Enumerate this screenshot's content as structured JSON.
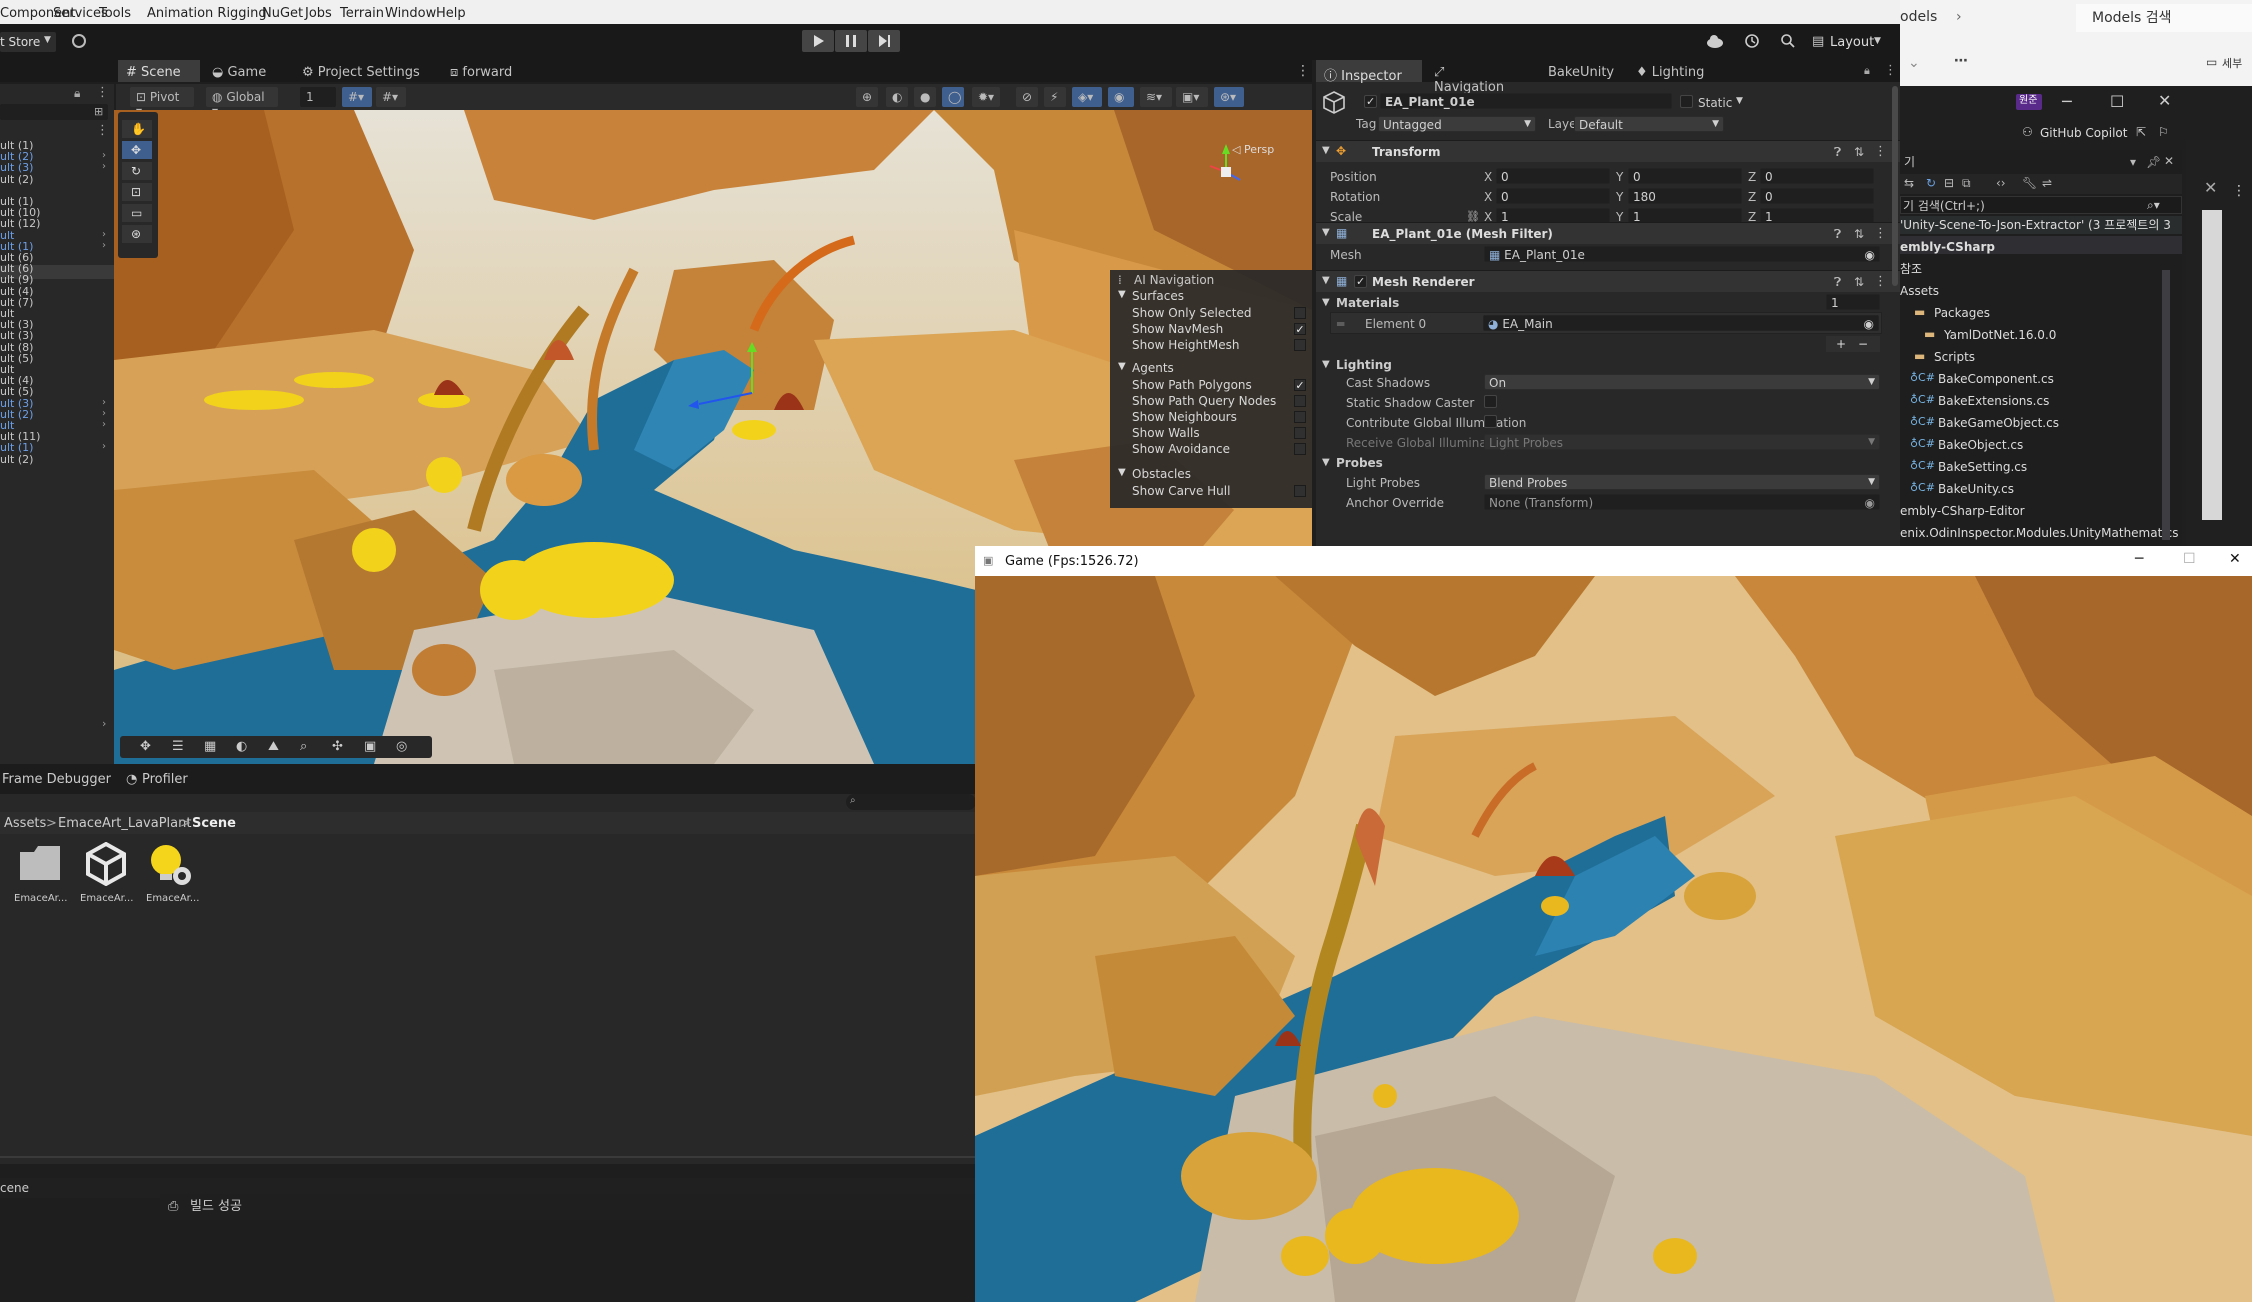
{
  "menubar": {
    "items": [
      "Component",
      "Services",
      "Tools",
      "Animation Rigging",
      "NuGet",
      "Jobs",
      "Terrain",
      "Window",
      "Help"
    ]
  },
  "toolbar": {
    "asset_store_label": "t Store",
    "layout_label": "Layout"
  },
  "scene_tabs": [
    {
      "label": "Scene",
      "icon": "grid-icon"
    },
    {
      "label": "Game",
      "icon": "gamepad-icon"
    },
    {
      "label": "Project Settings",
      "icon": "gear-icon"
    },
    {
      "label": "forward",
      "icon": "frame-icon"
    }
  ],
  "scene_toolbar": {
    "pivot_label": "Pivot",
    "global_label": "Global",
    "grid_value": "1"
  },
  "gizmo": {
    "persp_label": "◁ Persp"
  },
  "hierarchy": {
    "rows": [
      {
        "text": "ult (1)",
        "blue": false,
        "arrow": false
      },
      {
        "text": "ult (2)",
        "blue": true,
        "arrow": true
      },
      {
        "text": "ult (3)",
        "blue": true,
        "arrow": true
      },
      {
        "text": "ult (2)",
        "blue": false,
        "arrow": false
      },
      {
        "text": "",
        "blue": false,
        "arrow": false
      },
      {
        "text": "ult (1)",
        "blue": false,
        "arrow": false
      },
      {
        "text": "ult (10)",
        "blue": false,
        "arrow": false
      },
      {
        "text": "ult (12)",
        "blue": false,
        "arrow": false
      },
      {
        "text": "ult",
        "blue": true,
        "arrow": true
      },
      {
        "text": "ult (1)",
        "blue": true,
        "arrow": true
      },
      {
        "text": "ult (6)",
        "blue": false,
        "arrow": false
      },
      {
        "text": "ult (6)",
        "blue": false,
        "arrow": false
      },
      {
        "text": "ult (9)",
        "blue": false,
        "arrow": false
      },
      {
        "text": "ult (4)",
        "blue": false,
        "arrow": false
      },
      {
        "text": "ult (7)",
        "blue": false,
        "arrow": false
      },
      {
        "text": "ult",
        "blue": false,
        "arrow": false
      },
      {
        "text": "ult (3)",
        "blue": false,
        "arrow": false
      },
      {
        "text": "ult (3)",
        "blue": false,
        "arrow": false
      },
      {
        "text": "ult (8)",
        "blue": false,
        "arrow": false
      },
      {
        "text": "ult (5)",
        "blue": false,
        "arrow": false
      },
      {
        "text": "ult",
        "blue": false,
        "arrow": false
      },
      {
        "text": "ult (4)",
        "blue": false,
        "arrow": false
      },
      {
        "text": "ult (5)",
        "blue": false,
        "arrow": false
      },
      {
        "text": "ult (3)",
        "blue": true,
        "arrow": true
      },
      {
        "text": "ult (2)",
        "blue": true,
        "arrow": true
      },
      {
        "text": "ult",
        "blue": true,
        "arrow": true
      },
      {
        "text": "ult (11)",
        "blue": false,
        "arrow": false
      },
      {
        "text": "ult (1)",
        "blue": true,
        "arrow": true
      },
      {
        "text": "ult (2)",
        "blue": false,
        "arrow": false
      }
    ]
  },
  "ai_navigation": {
    "title": "AI Navigation",
    "surfaces_label": "Surfaces",
    "surfaces": [
      {
        "label": "Show Only Selected",
        "checked": false
      },
      {
        "label": "Show NavMesh",
        "checked": true
      },
      {
        "label": "Show HeightMesh",
        "checked": false
      }
    ],
    "agents_label": "Agents",
    "agents": [
      {
        "label": "Show Path Polygons",
        "checked": true
      },
      {
        "label": "Show Path Query Nodes",
        "checked": false
      },
      {
        "label": "Show Neighbours",
        "checked": false
      },
      {
        "label": "Show Walls",
        "checked": false
      },
      {
        "label": "Show Avoidance",
        "checked": false
      }
    ],
    "obstacles_label": "Obstacles",
    "obstacles": [
      {
        "label": "Show Carve Hull",
        "checked": false
      }
    ]
  },
  "bottom_tabs": {
    "frame_debugger": "Frame Debugger",
    "profiler": "Profiler"
  },
  "project": {
    "breadcrumb": [
      "Assets",
      "EmaceArt_LavaPlant",
      "Scene"
    ],
    "assets": [
      {
        "label": "EmaceAr...",
        "icon": "folder-icon"
      },
      {
        "label": "EmaceAr...",
        "icon": "unity-scene-icon"
      },
      {
        "label": "EmaceAr...",
        "icon": "lighting-settings-icon"
      }
    ]
  },
  "status": {
    "scene_label": "cene",
    "build_label": "빌드 성공"
  },
  "inspector": {
    "tabs": [
      "Inspector",
      "Navigation",
      "BakeUnity",
      "Lighting"
    ],
    "object_name": "EA_Plant_01e",
    "static_label": "Static",
    "tag_label": "Tag",
    "tag_value": "Untagged",
    "layer_label": "Layer",
    "layer_value": "Default",
    "transform": {
      "title": "Transform",
      "position_label": "Position",
      "position": [
        "0",
        "0",
        "0"
      ],
      "rotation_label": "Rotation",
      "rotation": [
        "0",
        "180",
        "0"
      ],
      "scale_label": "Scale",
      "scale": [
        "1",
        "1",
        "1"
      ]
    },
    "mesh_filter": {
      "title": "EA_Plant_01e (Mesh Filter)",
      "mesh_label": "Mesh",
      "mesh_value": "EA_Plant_01e"
    },
    "mesh_renderer": {
      "title": "Mesh Renderer",
      "materials_label": "Materials",
      "materials_count": "1",
      "element_label": "Element 0",
      "element_value": "EA_Main",
      "lighting_label": "Lighting",
      "cast_shadows_label": "Cast Shadows",
      "cast_shadows_value": "On",
      "static_shadow_label": "Static Shadow Caster",
      "contribute_gi_label": "Contribute Global Illumination",
      "receive_gi_label": "Receive Global Illumination",
      "receive_gi_value": "Light Probes",
      "probes_label": "Probes",
      "light_probes_label": "Light Probes",
      "light_probes_value": "Blend Probes",
      "anchor_label": "Anchor Override",
      "anchor_value": "None (Transform)"
    }
  },
  "vs": {
    "tab_models": "odels",
    "tab_models_search": "Models 검색",
    "tab_extra": "세부",
    "hangul_badge": "원준",
    "copilot_label": "GitHub Copilot",
    "search_label": "기 검색(Ctrl+;)",
    "solution_line": "'Unity-Scene-To-Json-Extractor'  (3 프로젝트의 3",
    "tree": [
      {
        "text": "embly-CSharp",
        "indent": 0,
        "bold": true,
        "icon": ""
      },
      {
        "text": "참조",
        "indent": 0,
        "bold": false,
        "icon": ""
      },
      {
        "text": "Assets",
        "indent": 0,
        "bold": false,
        "icon": ""
      },
      {
        "text": "Packages",
        "indent": 1,
        "bold": false,
        "icon": "folder"
      },
      {
        "text": "YamlDotNet.16.0.0",
        "indent": 2,
        "bold": false,
        "icon": "folder"
      },
      {
        "text": "Scripts",
        "indent": 1,
        "bold": false,
        "icon": "folder"
      },
      {
        "text": "BakeComponent.cs",
        "indent": 1,
        "bold": false,
        "icon": "cs"
      },
      {
        "text": "BakeExtensions.cs",
        "indent": 1,
        "bold": false,
        "icon": "cs"
      },
      {
        "text": "BakeGameObject.cs",
        "indent": 1,
        "bold": false,
        "icon": "cs"
      },
      {
        "text": "BakeObject.cs",
        "indent": 1,
        "bold": false,
        "icon": "cs"
      },
      {
        "text": "BakeSetting.cs",
        "indent": 1,
        "bold": false,
        "icon": "cs"
      },
      {
        "text": "BakeUnity.cs",
        "indent": 1,
        "bold": false,
        "icon": "cs"
      },
      {
        "text": "embly-CSharp-Editor",
        "indent": 0,
        "bold": false,
        "icon": ""
      },
      {
        "text": "enix.OdinInspector.Modules.UnityMathematics",
        "indent": 0,
        "bold": false,
        "icon": ""
      }
    ]
  },
  "game_window": {
    "title": "Game (Fps:1526.72)"
  },
  "colors": {
    "accent": "#4c7fc0",
    "selected_tab": "#3c3c3c",
    "lava_yellow": "#f2d21b",
    "river_blue": "#1f6e98",
    "rock": "#c98c3c"
  }
}
